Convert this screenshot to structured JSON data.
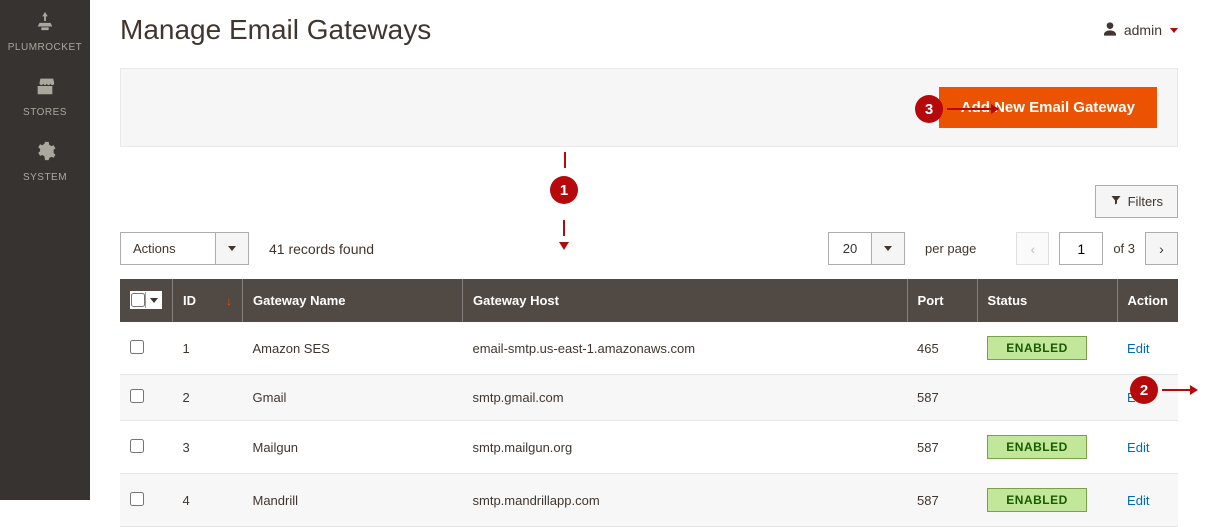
{
  "sidebar": {
    "items": [
      {
        "label": "PLUMROCKET",
        "icon": "plumrocket"
      },
      {
        "label": "STORES",
        "icon": "stores"
      },
      {
        "label": "SYSTEM",
        "icon": "system"
      }
    ]
  },
  "header": {
    "title": "Manage Email Gateways",
    "user": "admin"
  },
  "toolbar": {
    "add_button": "Add New Email Gateway"
  },
  "filters_button": "Filters",
  "grid": {
    "actions_label": "Actions",
    "records_found": "41 records found",
    "per_page": "20",
    "per_page_label": "per page",
    "current_page": "1",
    "of_label": "of 3"
  },
  "table": {
    "headers": {
      "id": "ID",
      "name": "Gateway Name",
      "host": "Gateway Host",
      "port": "Port",
      "status": "Status",
      "action": "Action"
    },
    "rows": [
      {
        "id": "1",
        "name": "Amazon SES",
        "host": "email-smtp.us-east-1.amazonaws.com",
        "port": "465",
        "status": "ENABLED",
        "action": "Edit"
      },
      {
        "id": "2",
        "name": "Gmail",
        "host": "smtp.gmail.com",
        "port": "587",
        "status": "",
        "action": "Edit"
      },
      {
        "id": "3",
        "name": "Mailgun",
        "host": "smtp.mailgun.org",
        "port": "587",
        "status": "ENABLED",
        "action": "Edit"
      },
      {
        "id": "4",
        "name": "Mandrill",
        "host": "smtp.mandrillapp.com",
        "port": "587",
        "status": "ENABLED",
        "action": "Edit"
      }
    ]
  },
  "annotations": {
    "a1": "1",
    "a2": "2",
    "a3": "3"
  }
}
